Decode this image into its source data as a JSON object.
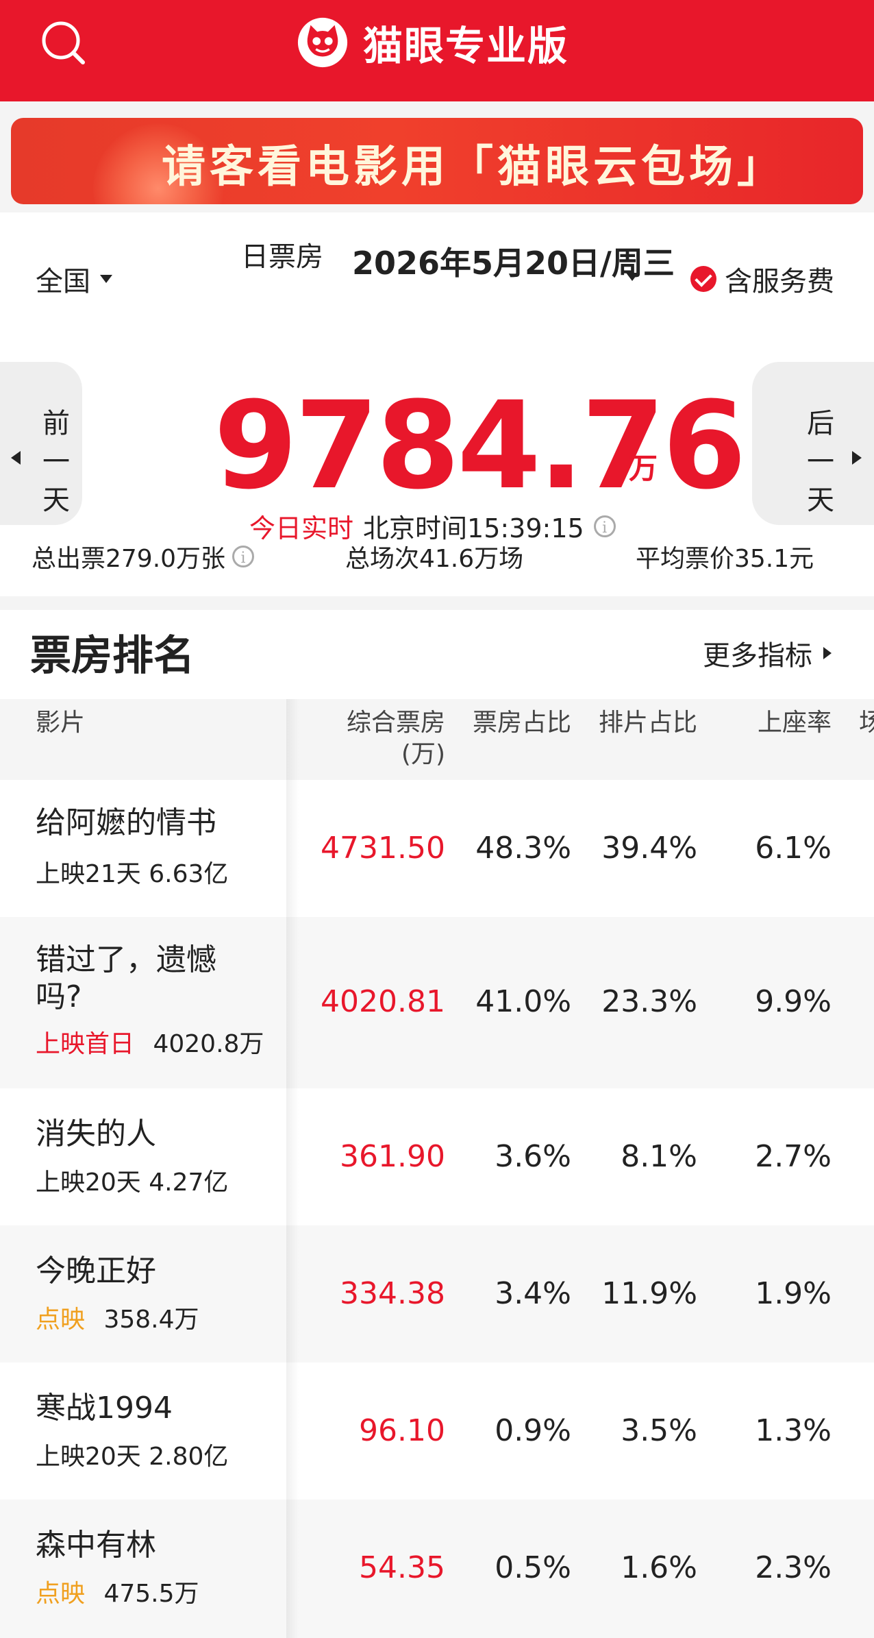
{
  "header": {
    "title": "猫眼专业版"
  },
  "banner": {
    "text": "请客看电影用「猫眼云包场」"
  },
  "filters": {
    "region": "全国",
    "type": "日票房",
    "date": "2026年5月20日/周三",
    "fee_label": "含服务费"
  },
  "summary": {
    "prev_day": "前一天",
    "next_day": "后一天",
    "total": "9784.76",
    "unit": "万",
    "realtime_label": "今日实时",
    "time_label": "北京时间15:39:15",
    "tickets": "总出票279.0万张",
    "shows": "总场次41.6万场",
    "avg_price": "平均票价35.1元"
  },
  "ranking": {
    "title": "票房排名",
    "more": "更多指标",
    "columns": {
      "film": "影片",
      "box_line1": "综合票房",
      "box_line2": "(万)",
      "box_share": "票房占比",
      "show_share": "排片占比",
      "occupancy": "上座率",
      "extra": "场"
    },
    "rows": [
      {
        "name": "给阿嬷的情书",
        "tag": "",
        "sub": "上映21天  6.63亿",
        "box": "4731.50",
        "box_share": "48.3%",
        "show_share": "39.4%",
        "occupancy": "6.1%"
      },
      {
        "name": "错过了，遗憾吗?",
        "tag": "上映首日",
        "sub": "4020.8万",
        "box": "4020.81",
        "box_share": "41.0%",
        "show_share": "23.3%",
        "occupancy": "9.9%"
      },
      {
        "name": "消失的人",
        "tag": "",
        "sub": "上映20天  4.27亿",
        "box": "361.90",
        "box_share": "3.6%",
        "show_share": "8.1%",
        "occupancy": "2.7%"
      },
      {
        "name": "今晚正好",
        "tag": "点映",
        "sub": "358.4万",
        "box": "334.38",
        "box_share": "3.4%",
        "show_share": "11.9%",
        "occupancy": "1.9%"
      },
      {
        "name": "寒战1994",
        "tag": "",
        "sub": "上映20天  2.80亿",
        "box": "96.10",
        "box_share": "0.9%",
        "show_share": "3.5%",
        "occupancy": "1.3%"
      },
      {
        "name": "森中有林",
        "tag": "点映",
        "sub": "475.5万",
        "box": "54.35",
        "box_share": "0.5%",
        "show_share": "1.6%",
        "occupancy": "2.3%"
      }
    ]
  },
  "colors": {
    "brand_red": "#e8172b",
    "tag_orange": "#f0a020"
  }
}
